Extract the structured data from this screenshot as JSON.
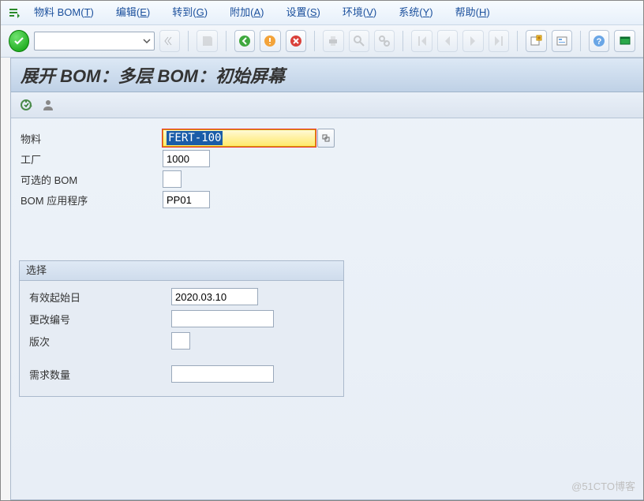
{
  "menu": {
    "items": [
      {
        "label": "物料 BOM",
        "key": "T"
      },
      {
        "label": "编辑",
        "key": "E"
      },
      {
        "label": "转到",
        "key": "G"
      },
      {
        "label": "附加",
        "key": "A"
      },
      {
        "label": "设置",
        "key": "S"
      },
      {
        "label": "环境",
        "key": "V"
      },
      {
        "label": "系统",
        "key": "Y"
      },
      {
        "label": "帮助",
        "key": "H"
      }
    ]
  },
  "toolbar": {
    "ok_code": ""
  },
  "page": {
    "title": "展开 BOM：多层 BOM：初始屏幕"
  },
  "form": {
    "material_label": "物料",
    "material_value": "FERT-100",
    "plant_label": "工厂",
    "plant_value": "1000",
    "altbom_label": "可选的 BOM",
    "altbom_value": "",
    "bomapp_label": "BOM 应用程序",
    "bomapp_value": "PP01"
  },
  "group": {
    "title": "选择",
    "validfrom_label": "有效起始日",
    "validfrom_value": "2020.03.10",
    "changeno_label": "更改编号",
    "changeno_value": "",
    "revision_label": "版次",
    "revision_value": "",
    "reqqty_label": "需求数量",
    "reqqty_value": ""
  },
  "watermark": "@51CTO博客"
}
